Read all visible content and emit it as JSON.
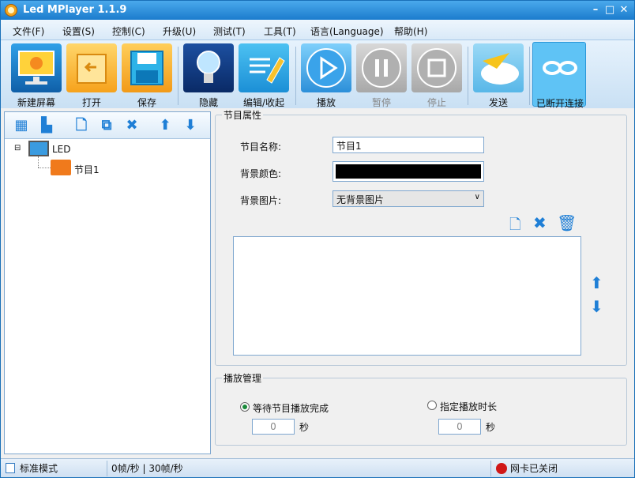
{
  "window": {
    "title": "Led MPlayer 1.1.9"
  },
  "menu": [
    "文件(F)",
    "设置(S)",
    "控制(C)",
    "升级(U)",
    "测试(T)",
    "工具(T)",
    "语言(Language)",
    "帮助(H)"
  ],
  "toolbar": [
    {
      "label": "新建屏幕",
      "icon": "monitor-icon"
    },
    {
      "label": "打开",
      "icon": "folder-open-icon"
    },
    {
      "label": "保存",
      "icon": "floppy-icon"
    },
    {
      "label": "隐藏",
      "icon": "lightbulb-icon"
    },
    {
      "label": "编辑/收起",
      "icon": "edit-pencil-icon"
    },
    {
      "label": "播放",
      "icon": "play-icon"
    },
    {
      "label": "暂停",
      "icon": "pause-icon"
    },
    {
      "label": "停止",
      "icon": "stop-icon"
    },
    {
      "label": "发送",
      "icon": "send-cloud-icon"
    },
    {
      "label": "已断开连接",
      "icon": "disconnected-link-icon"
    }
  ],
  "tree": {
    "root": "LED",
    "child": "节目1"
  },
  "program": {
    "group_title": "节目属性",
    "name_label": "节目名称:",
    "name_value": "节目1",
    "bgcolor_label": "背景颜色:",
    "bgcolor_value": "#000000",
    "bgimage_label": "背景图片:",
    "bgimage_value": "无背景图片"
  },
  "playback": {
    "group_title": "播放管理",
    "option1": "等待节目播放完成",
    "option1_value": "0",
    "option1_unit": "秒",
    "option2": "指定播放时长",
    "option2_value": "0",
    "option2_unit": "秒"
  },
  "status": {
    "mode": "标准模式",
    "fps": "0帧/秒 | 30帧/秒",
    "network": "网卡已关闭"
  }
}
